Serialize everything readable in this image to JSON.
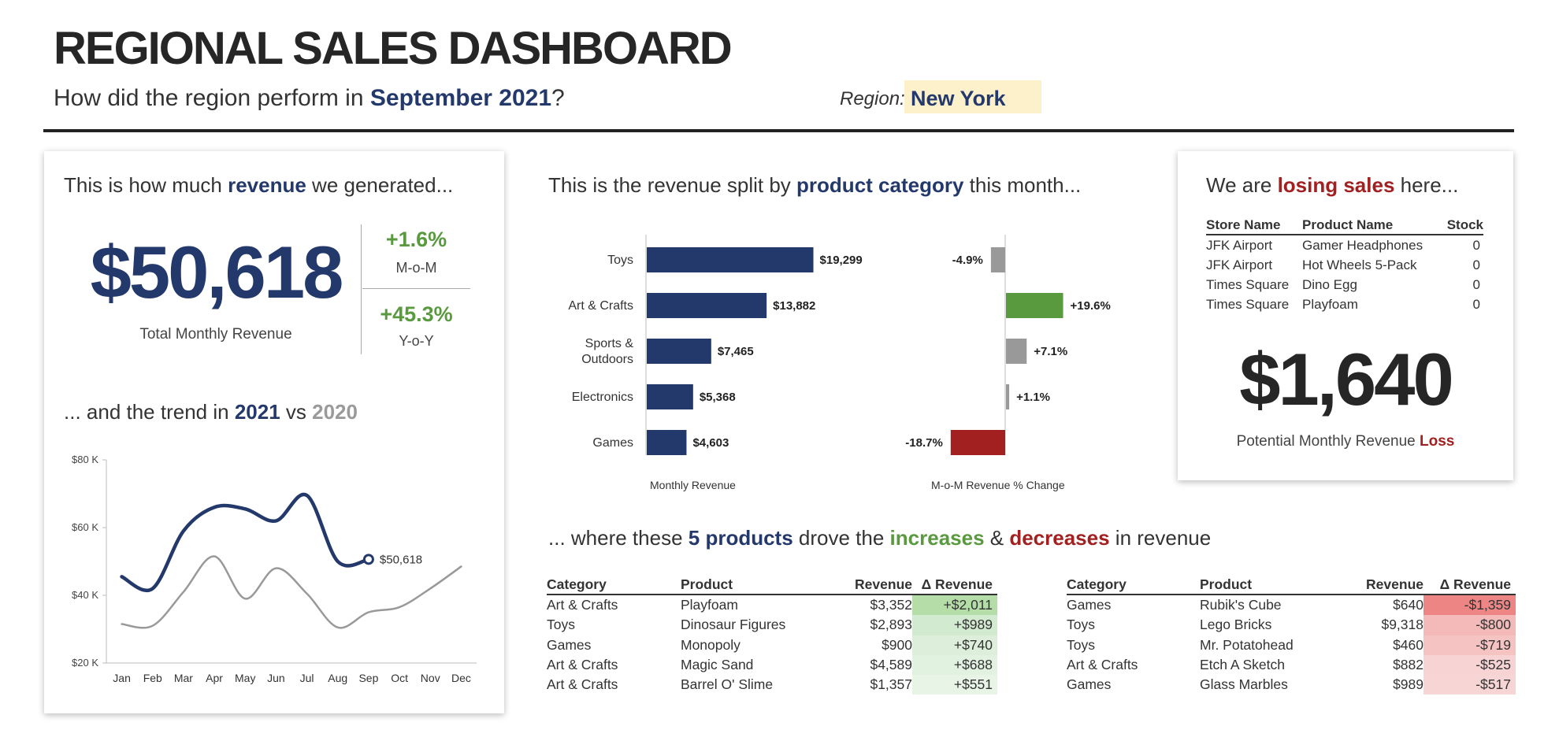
{
  "header": {
    "title": "REGIONAL SALES DASHBOARD",
    "subtitle_prefix": "How did the region perform in ",
    "subtitle_month": "September 2021",
    "subtitle_suffix": "?",
    "region_label": "Region:",
    "region_value": "New York"
  },
  "revenue_card": {
    "heading_prefix": "This is how much ",
    "heading_bold": "revenue",
    "heading_suffix": " we generated...",
    "total_value": "$50,618",
    "total_label": "Total Monthly Revenue",
    "mom_value": "+1.6%",
    "mom_label": "M-o-M",
    "yoy_value": "+45.3%",
    "yoy_label": "Y-o-Y",
    "trend_prefix": "... and the trend in ",
    "trend_year_current": "2021",
    "trend_vs": " vs ",
    "trend_year_prior": "2020"
  },
  "category_card": {
    "heading_prefix": "This is the revenue split by ",
    "heading_bold": "product category",
    "heading_suffix": " this month..."
  },
  "products_section": {
    "heading_prefix": "... where these ",
    "heading_count": "5 products",
    "heading_mid": " drove the ",
    "heading_increase": "increases",
    "heading_amp": " & ",
    "heading_decrease": "decreases",
    "heading_suffix": " in revenue",
    "columns": [
      "Category",
      "Product",
      "Revenue",
      "Δ Revenue"
    ],
    "increases": [
      {
        "category": "Art & Crafts",
        "product": "Playfoam",
        "revenue": "$3,352",
        "delta": "+$2,011",
        "shade": "#b5dda8"
      },
      {
        "category": "Toys",
        "product": "Dinosaur Figures",
        "revenue": "$2,893",
        "delta": "+$989",
        "shade": "#d2ead0"
      },
      {
        "category": "Games",
        "product": "Monopoly",
        "revenue": "$900",
        "delta": "+$740",
        "shade": "#ddefdb"
      },
      {
        "category": "Art & Crafts",
        "product": "Magic Sand",
        "revenue": "$4,589",
        "delta": "+$688",
        "shade": "#e2f2e0"
      },
      {
        "category": "Art & Crafts",
        "product": "Barrel O' Slime",
        "revenue": "$1,357",
        "delta": "+$551",
        "shade": "#e8f5e6"
      }
    ],
    "decreases": [
      {
        "category": "Games",
        "product": "Rubik's Cube",
        "revenue": "$640",
        "delta": "-$1,359",
        "shade": "#ee8585"
      },
      {
        "category": "Toys",
        "product": "Lego Bricks",
        "revenue": "$9,318",
        "delta": "-$800",
        "shade": "#f4b9b9"
      },
      {
        "category": "Toys",
        "product": "Mr. Potatohead",
        "revenue": "$460",
        "delta": "-$719",
        "shade": "#f6c3c3"
      },
      {
        "category": "Art & Crafts",
        "product": "Etch A Sketch",
        "revenue": "$882",
        "delta": "-$525",
        "shade": "#f8d3d3"
      },
      {
        "category": "Games",
        "product": "Glass Marbles",
        "revenue": "$989",
        "delta": "-$517",
        "shade": "#f8d5d5"
      }
    ]
  },
  "losing_card": {
    "heading_prefix": "We are ",
    "heading_bold": "losing sales",
    "heading_suffix": " here...",
    "columns": [
      "Store Name",
      "Product Name",
      "Stock"
    ],
    "rows": [
      {
        "store": "JFK Airport",
        "product": "Gamer Headphones",
        "stock": "0"
      },
      {
        "store": "JFK Airport",
        "product": "Hot Wheels 5-Pack",
        "stock": "0"
      },
      {
        "store": "Times Square",
        "product": "Dino Egg",
        "stock": "0"
      },
      {
        "store": "Times Square",
        "product": "Playfoam",
        "stock": "0"
      }
    ],
    "loss_value": "$1,640",
    "loss_label_prefix": "Potential Monthly Revenue ",
    "loss_label_bold": "Loss"
  },
  "colors": {
    "navy": "#24396b",
    "green": "#5a9a3f",
    "red": "#a32020",
    "grey": "#9a9a9a",
    "highlight": "#fdf1cc"
  },
  "chart_data": [
    {
      "type": "line",
      "title": "",
      "x": [
        "Jan",
        "Feb",
        "Mar",
        "Apr",
        "May",
        "Jun",
        "Jul",
        "Aug",
        "Sep",
        "Oct",
        "Nov",
        "Dec"
      ],
      "ylim": [
        20000,
        80000
      ],
      "yticks": [
        20000,
        40000,
        60000,
        80000
      ],
      "ytick_labels": [
        "$20 K",
        "$40 K",
        "$60 K",
        "$80 K"
      ],
      "grid": false,
      "series": [
        {
          "name": "2021",
          "color": "#24396b",
          "values": [
            45500,
            42000,
            59000,
            66000,
            65500,
            62000,
            69500,
            50000,
            50618,
            null,
            null,
            null
          ]
        },
        {
          "name": "2020",
          "color": "#999999",
          "values": [
            31500,
            31000,
            41000,
            51500,
            39000,
            48000,
            40500,
            30500,
            35000,
            36500,
            42000,
            48500
          ]
        }
      ],
      "annotations": [
        {
          "label": "$50,618"
        }
      ]
    },
    {
      "type": "bar",
      "orientation": "horizontal",
      "categories": [
        "Toys",
        "Art & Crafts",
        "Sports & Outdoors",
        "Electronics",
        "Games"
      ],
      "xlabel": "Monthly Revenue",
      "series": [
        {
          "values": [
            19299,
            13882,
            7465,
            5368,
            4603
          ]
        }
      ],
      "data_labels": [
        "$19,299",
        "$13,882",
        "$7,465",
        "$5,368",
        "$4,603"
      ],
      "bar_color": "#24396b"
    },
    {
      "type": "bar",
      "orientation": "horizontal",
      "categories": [
        "Toys",
        "Art & Crafts",
        "Sports & Outdoors",
        "Electronics",
        "Games"
      ],
      "xlabel": "M-o-M Revenue % Change",
      "series": [
        {
          "values": [
            -4.9,
            19.6,
            7.1,
            1.1,
            -18.7
          ]
        }
      ],
      "data_labels": [
        "-4.9%",
        "+19.6%",
        "+7.1%",
        "+1.1%",
        "-18.7%"
      ],
      "bar_colors": [
        "#999999",
        "#5a9a3f",
        "#999999",
        "#999999",
        "#a32020"
      ]
    }
  ]
}
